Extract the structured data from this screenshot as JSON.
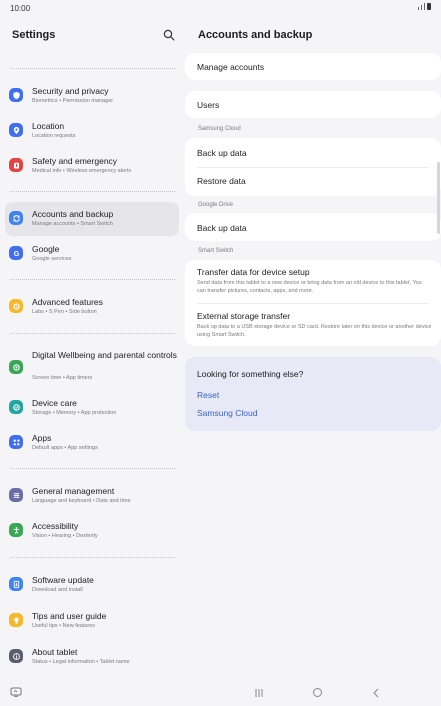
{
  "status": {
    "time": "10:00"
  },
  "left": {
    "title": "Settings",
    "items": [
      {
        "title": "Security and privacy",
        "sub": "Biometrics  •  Permission manager",
        "color": "#3f6ef0",
        "icon": "shield-icon"
      },
      {
        "title": "Location",
        "sub": "Location requests",
        "color": "#3f6ef0",
        "icon": "location-pin-icon"
      },
      {
        "title": "Safety and emergency",
        "sub": "Medical info  •  Wireless emergency alerts",
        "color": "#e44242",
        "icon": "emergency-icon"
      },
      {
        "title": "Accounts and backup",
        "sub": "Manage accounts  •  Smart Switch",
        "color": "#3f84f0",
        "icon": "sync-icon"
      },
      {
        "title": "Google",
        "sub": "Google services",
        "color": "#3f6ef0",
        "icon": "google-icon"
      },
      {
        "title": "Advanced features",
        "sub": "Labs  •  S Pen  •  Side button",
        "color": "#f5b82e",
        "icon": "gear-plus-icon"
      },
      {
        "title": "Digital Wellbeing and parental controls",
        "sub": "Screen time  •  App timers",
        "color": "#3aa757",
        "icon": "wellbeing-icon"
      },
      {
        "title": "Device care",
        "sub": "Storage  •  Memory  •  App protection",
        "color": "#21a6a1",
        "icon": "device-care-icon"
      },
      {
        "title": "Apps",
        "sub": "Default apps  •  App settings",
        "color": "#3f6ef0",
        "icon": "apps-grid-icon"
      },
      {
        "title": "General management",
        "sub": "Language and keyboard  •  Date and time",
        "color": "#6b6fa8",
        "icon": "sliders-icon"
      },
      {
        "title": "Accessibility",
        "sub": "Vision  •  Hearing  •  Dexterity",
        "color": "#3aa757",
        "icon": "accessibility-icon"
      },
      {
        "title": "Software update",
        "sub": "Download and install",
        "color": "#3f84f0",
        "icon": "update-icon"
      },
      {
        "title": "Tips and user guide",
        "sub": "Useful tips  •  New features",
        "color": "#f5b82e",
        "icon": "bulb-icon"
      },
      {
        "title": "About tablet",
        "sub": "Status  •  Legal information  •  Tablet name",
        "color": "#5a5d6e",
        "icon": "info-icon"
      }
    ]
  },
  "right": {
    "title": "Accounts and backup",
    "manage_accounts": "Manage accounts",
    "users": "Users",
    "samsung_cloud_label": "Samsung Cloud",
    "back_up_data": "Back up data",
    "restore_data": "Restore data",
    "google_drive_label": "Google Drive",
    "google_back_up": "Back up data",
    "smart_switch_label": "Smart Switch",
    "transfer_title": "Transfer data for device setup",
    "transfer_sub": "Send data from this tablet to a new device or bring data from an old device to this tablet. You can transfer pictures, contacts, apps, and more.",
    "external_title": "External storage transfer",
    "external_sub": "Back up data to a USB storage device or SD card. Restore later on this device or another device using Smart Switch.",
    "help": {
      "title": "Looking for something else?",
      "link1": "Reset",
      "link2": "Samsung Cloud"
    }
  }
}
